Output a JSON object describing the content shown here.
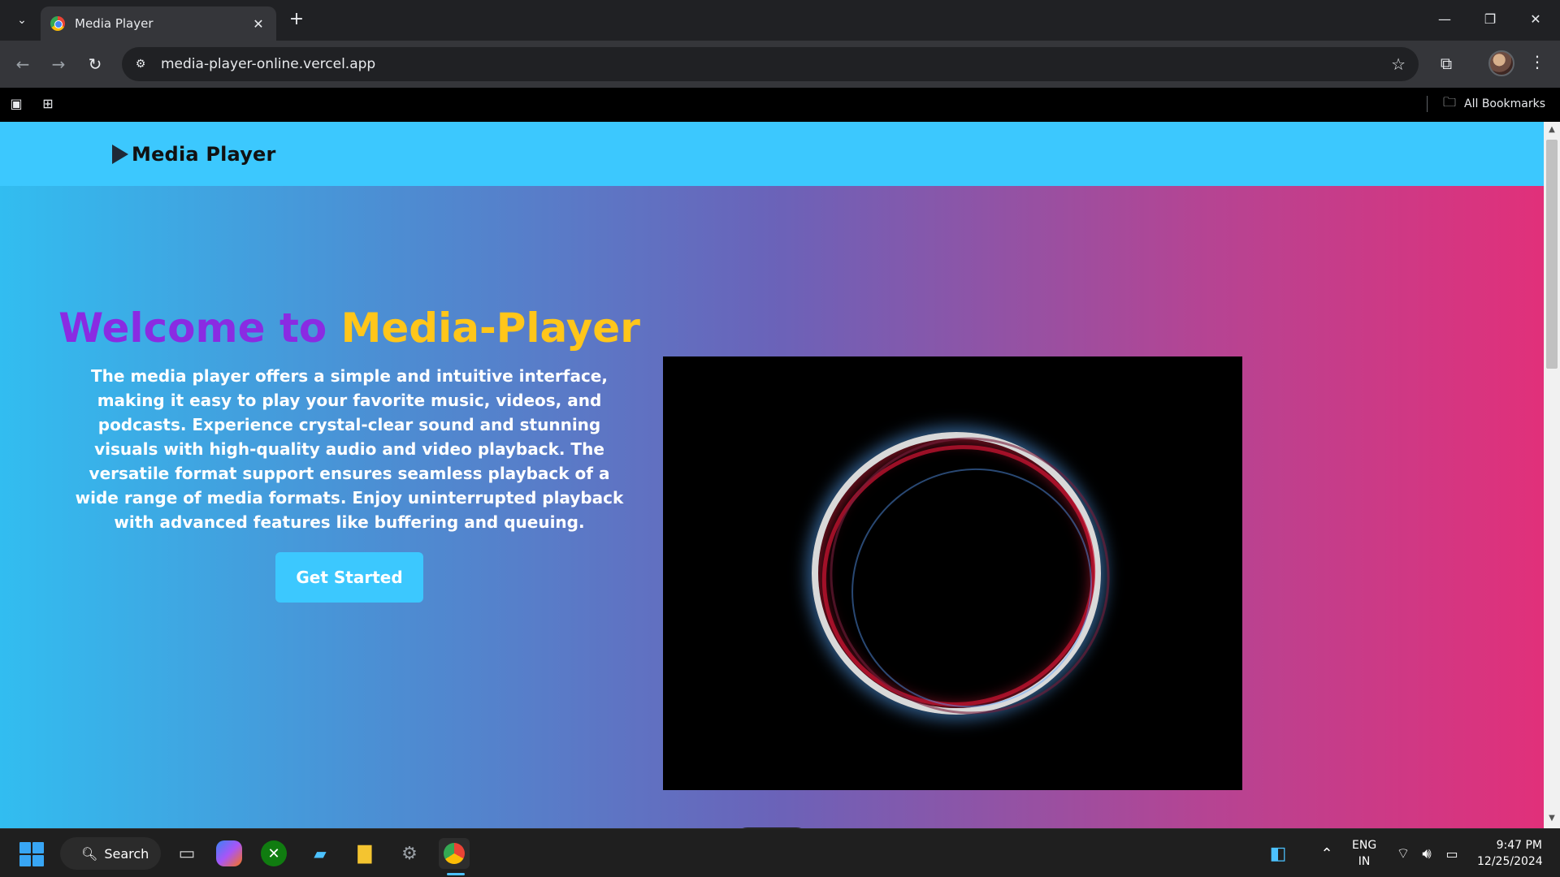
{
  "browser": {
    "tab_title": "Media Player",
    "new_tab_symbol": "+",
    "url": "media-player-online.vercel.app",
    "all_bookmarks": "All Bookmarks",
    "window_controls": {
      "minimize": "—",
      "restore": "❐",
      "close": "✕"
    }
  },
  "site": {
    "logo_text": "Media Player",
    "hero": {
      "title_part1": "Welcome to",
      "title_part2": "Media-Player",
      "description": "The media player offers a simple and intuitive interface, making it easy to play your favorite music, videos, and podcasts. Experience crystal-clear sound and stunning visuals with high-quality audio and video playback. The versatile format support ensures seamless playback of a wide range of media formats. Enjoy uninterrupted playback with advanced features like buffering and queuing.",
      "cta_label": "Get Started"
    },
    "colors": {
      "header_bg": "#3cc8fe",
      "title_purple": "#8a2be2",
      "title_yellow": "#ffc61a",
      "gradient_start": "#32bdf0",
      "gradient_end": "#e1307a"
    }
  },
  "taskbar": {
    "search_label": "Search",
    "language_line1": "ENG",
    "language_line2": "IN",
    "time": "9:47 PM",
    "date": "12/25/2024",
    "apps": [
      "task-view",
      "copilot",
      "xbox",
      "store",
      "file-explorer",
      "settings",
      "chrome"
    ]
  }
}
